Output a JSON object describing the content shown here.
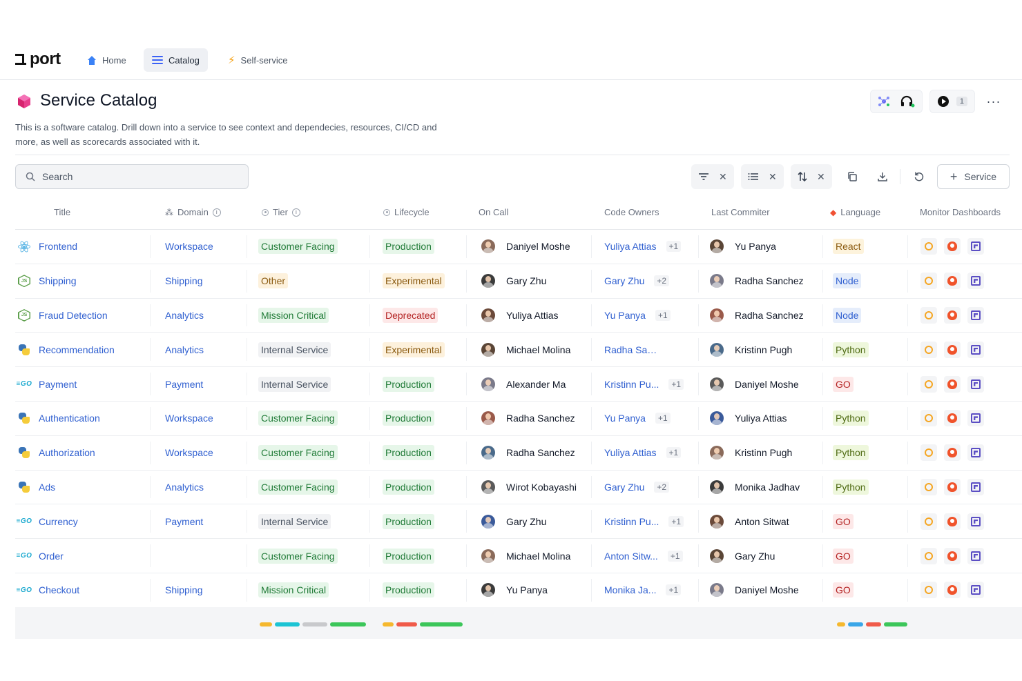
{
  "nav": {
    "logo": "port",
    "tabs": [
      {
        "label": "Home"
      },
      {
        "label": "Catalog"
      },
      {
        "label": "Self-service"
      }
    ]
  },
  "header": {
    "title": "Service Catalog",
    "description": "This is a software catalog. Drill down into a service to see context and dependecies, resources, CI/CD and more, as well as scorecards associated with it.",
    "badge_count": "1"
  },
  "toolbar": {
    "search_placeholder": "Search",
    "add_label": "Service"
  },
  "columns": {
    "title": "Title",
    "domain": "Domain",
    "tier": "Tier",
    "lifecycle": "Lifecycle",
    "oncall": "On Call",
    "owners": "Code Owners",
    "committer": "Last Commiter",
    "language": "Language",
    "monitors": "Monitor Dashboards"
  },
  "rows": [
    {
      "title": "Frontend",
      "icon": "react-icon",
      "domain": "Workspace",
      "tier": "Customer Facing",
      "lifecycle": "Production",
      "oncall": "Daniyel Moshe",
      "owner": "Yuliya Attias",
      "owner_extra": "+1",
      "committer": "Yu Panya",
      "language": "React"
    },
    {
      "title": "Shipping",
      "icon": "nodejs-icon",
      "domain": "Shipping",
      "tier": "Other",
      "lifecycle": "Experimental",
      "oncall": "Gary Zhu",
      "owner": "Gary Zhu",
      "owner_extra": "+2",
      "committer": "Radha Sanchez",
      "language": "Node"
    },
    {
      "title": "Fraud Detection",
      "icon": "nodejs-icon",
      "domain": "Analytics",
      "tier": "Mission Critical",
      "lifecycle": "Deprecated",
      "oncall": "Yuliya Attias",
      "owner": "Yu Panya",
      "owner_extra": "+1",
      "committer": "Radha Sanchez",
      "language": "Node"
    },
    {
      "title": "Recommendation",
      "icon": "python-icon",
      "domain": "Analytics",
      "tier": "Internal Service",
      "lifecycle": "Experimental",
      "oncall": "Michael Molina",
      "owner": "Radha Sanchez",
      "owner_extra": "",
      "committer": "Kristinn Pugh",
      "language": "Python"
    },
    {
      "title": "Payment",
      "icon": "go-icon",
      "domain": "Payment",
      "tier": "Internal Service",
      "lifecycle": "Production",
      "oncall": "Alexander Ma",
      "owner": "Kristinn Pu...",
      "owner_extra": "+1",
      "committer": "Daniyel Moshe",
      "language": "GO"
    },
    {
      "title": "Authentication",
      "icon": "python-icon",
      "domain": "Workspace",
      "tier": "Customer Facing",
      "lifecycle": "Production",
      "oncall": "Radha Sanchez",
      "owner": "Yu Panya",
      "owner_extra": "+1",
      "committer": "Yuliya Attias",
      "language": "Python"
    },
    {
      "title": "Authorization",
      "icon": "python-icon",
      "domain": "Workspace",
      "tier": "Customer Facing",
      "lifecycle": "Production",
      "oncall": "Radha Sanchez",
      "owner": "Yuliya Attias",
      "owner_extra": "+1",
      "committer": "Kristinn Pugh",
      "language": "Python"
    },
    {
      "title": "Ads",
      "icon": "python-icon",
      "domain": "Analytics",
      "tier": "Customer Facing",
      "lifecycle": "Production",
      "oncall": "Wirot Kobayashi",
      "owner": "Gary Zhu",
      "owner_extra": "+2",
      "committer": "Monika Jadhav",
      "language": "Python"
    },
    {
      "title": "Currency",
      "icon": "go-icon",
      "domain": "Payment",
      "tier": "Internal Service",
      "lifecycle": "Production",
      "oncall": "Gary Zhu",
      "owner": "Kristinn Pu...",
      "owner_extra": "+1",
      "committer": "Anton Sitwat",
      "language": "GO"
    },
    {
      "title": "Order",
      "icon": "go-icon",
      "domain": "",
      "tier": "Customer Facing",
      "lifecycle": "Production",
      "oncall": "Michael Molina",
      "owner": "Anton Sitw...",
      "owner_extra": "+1",
      "committer": "Gary Zhu",
      "language": "GO"
    },
    {
      "title": "Checkout",
      "icon": "go-icon",
      "domain": "Shipping",
      "tier": "Mission Critical",
      "lifecycle": "Production",
      "oncall": "Yu Panya",
      "owner": "Monika Ja...",
      "owner_extra": "+1",
      "committer": "Daniyel Moshe",
      "language": "GO"
    }
  ],
  "colors": {
    "accent": "#2f5fd0",
    "tier": {
      "Customer Facing": "green",
      "Other": "orange",
      "Mission Critical": "green",
      "Internal Service": "grey"
    },
    "lifecycle": {
      "Production": "green",
      "Experimental": "orange",
      "Deprecated": "red"
    },
    "language": {
      "React": "react",
      "Node": "blue",
      "Python": "yellowg",
      "GO": "red"
    },
    "avatars": [
      "#8a6a5a",
      "#3b3b3b",
      "#6b4a3a",
      "#5a4536",
      "#7a7a8a",
      "#9a5a4a",
      "#4a6a8a",
      "#5a5a5a",
      "#3a5a9a"
    ]
  }
}
